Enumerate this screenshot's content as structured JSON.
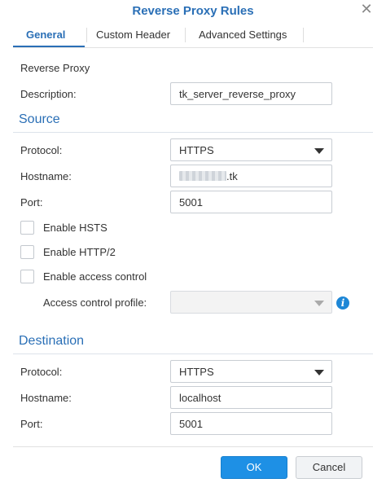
{
  "dialog": {
    "title": "Reverse Proxy Rules",
    "close_icon": "close-icon"
  },
  "tabs": [
    {
      "label": "General",
      "active": true
    },
    {
      "label": "Custom Header",
      "active": false
    },
    {
      "label": "Advanced Settings",
      "active": false
    }
  ],
  "general": {
    "heading": "Reverse Proxy",
    "description_label": "Description:",
    "description_value": "tk_server_reverse_proxy"
  },
  "source": {
    "heading": "Source",
    "protocol_label": "Protocol:",
    "protocol_value": "HTTPS",
    "hostname_label": "Hostname:",
    "hostname_suffix": ".tk",
    "port_label": "Port:",
    "port_value": "5001",
    "enable_hsts_label": "Enable HSTS",
    "enable_http2_label": "Enable HTTP/2",
    "enable_access_control_label": "Enable access control",
    "access_profile_label": "Access control profile:",
    "access_profile_value": ""
  },
  "destination": {
    "heading": "Destination",
    "protocol_label": "Protocol:",
    "protocol_value": "HTTPS",
    "hostname_label": "Hostname:",
    "hostname_value": "localhost",
    "port_label": "Port:",
    "port_value": "5001"
  },
  "footer": {
    "ok_label": "OK",
    "cancel_label": "Cancel"
  },
  "colors": {
    "accent": "#2a6fb6",
    "primary_button": "#1e90e5",
    "info_icon": "#1e87d6"
  }
}
